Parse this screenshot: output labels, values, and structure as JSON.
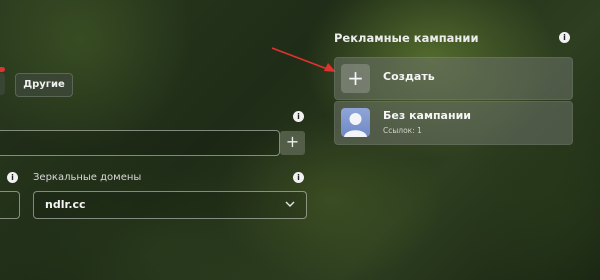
{
  "left_form": {
    "other_button_label": "Другие",
    "plus_label": "+",
    "mirror_domains_label": "Зеркальные домены",
    "mirror_domain_value": "ndlr.cc",
    "info_glyph": "i"
  },
  "campaigns_panel": {
    "title": "Рекламные кампании",
    "create_icon": "+",
    "create_label": "Создать",
    "items": [
      {
        "name": "Без кампании",
        "links": "Ссылок: 1"
      }
    ]
  },
  "colors": {
    "annotation_arrow": "#e0322f"
  },
  "icons": {
    "info": "info-icon",
    "add": "plus-icon",
    "dropdown": "chevron-down-icon",
    "avatar": "user-avatar-icon"
  }
}
